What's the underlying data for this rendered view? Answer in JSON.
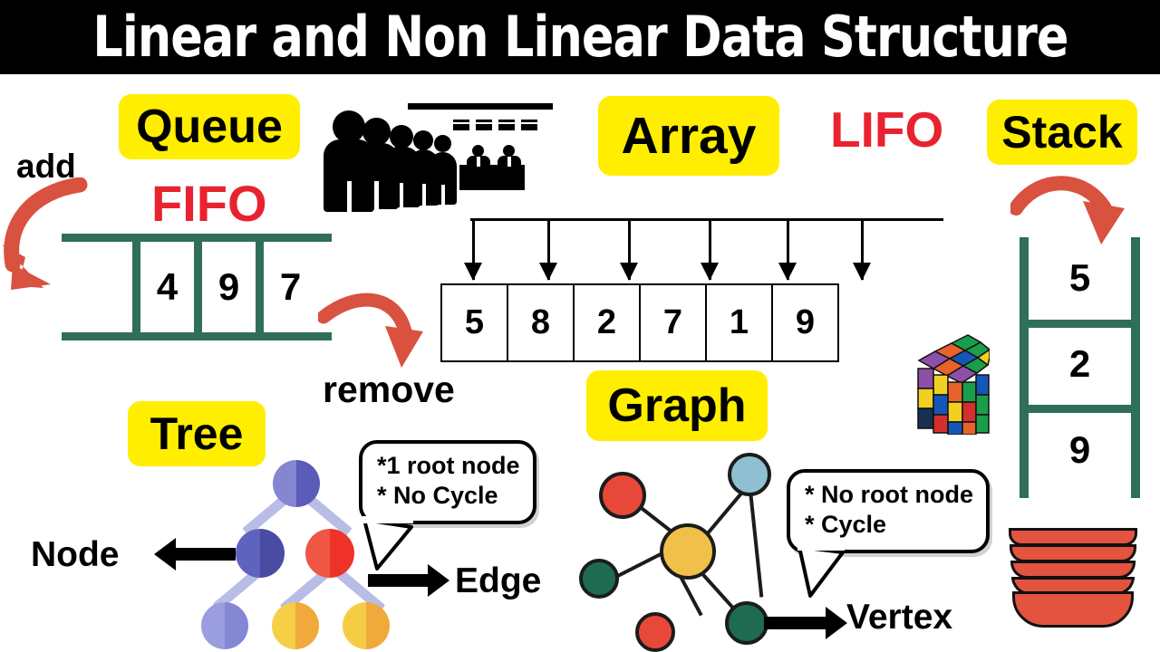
{
  "header": {
    "title": "Linear and Non Linear Data Structure",
    "bg_color": "#000000",
    "text_color": "#ffffff"
  },
  "theme": {
    "badge_bg": "#ffee00",
    "accent_red": "#e8232f",
    "arrow_red": "#d9513f",
    "queue_green": "#2f6e5a",
    "plate_red": "#e3533f"
  },
  "queue": {
    "badge_label": "Queue",
    "principle_label": "FIFO",
    "add_label": "add",
    "remove_label": "remove",
    "cells": [
      "4",
      "9",
      "7"
    ],
    "illustration": "people-in-line-at-counter-icon"
  },
  "array": {
    "badge_label": "Array",
    "cells": [
      "5",
      "8",
      "2",
      "7",
      "1",
      "9"
    ],
    "index_arrow_count": 6
  },
  "stack": {
    "badge_label": "Stack",
    "principle_label": "LIFO",
    "cells": [
      "5",
      "2",
      "9"
    ],
    "illustration": "stack-of-plates-icon",
    "cube_illustration": "rubiks-cube-icon"
  },
  "tree": {
    "badge_label": "Tree",
    "node_label": "Node",
    "edge_label": "Edge",
    "callout": [
      "*1 root node",
      "*  No Cycle"
    ],
    "nodes": [
      {
        "name": "root",
        "left_color": "#8486cf",
        "right_color": "#5a5cb7"
      },
      {
        "name": "left-child",
        "left_color": "#6063bd",
        "right_color": "#4a4ca3"
      },
      {
        "name": "right-child",
        "left_color": "#ef5644",
        "right_color": "#ee322a"
      },
      {
        "name": "leaf-1",
        "left_color": "#9a9ddf",
        "right_color": "#8487d4"
      },
      {
        "name": "leaf-2",
        "left_color": "#f5cf46",
        "right_color": "#f1a93c"
      },
      {
        "name": "leaf-3",
        "left_color": "#f5cd45",
        "right_color": "#f0a93b"
      }
    ]
  },
  "graph": {
    "badge_label": "Graph",
    "vertex_label": "Vertex",
    "callout": [
      "*  No  root node",
      "* Cycle"
    ],
    "nodes": [
      {
        "name": "hub",
        "color": "#f0c04a"
      },
      {
        "name": "red-top",
        "color": "#e8483a"
      },
      {
        "name": "blue-top",
        "color": "#8fc0d2"
      },
      {
        "name": "green-left",
        "color": "#1e6b52"
      },
      {
        "name": "red-bottom",
        "color": "#e8483a"
      },
      {
        "name": "green-bottom",
        "color": "#1e6b52"
      }
    ],
    "edges": [
      [
        "hub",
        "red-top"
      ],
      [
        "hub",
        "blue-top"
      ],
      [
        "hub",
        "green-left"
      ],
      [
        "hub",
        "red-bottom"
      ],
      [
        "hub",
        "green-bottom"
      ],
      [
        "blue-top",
        "green-bottom"
      ]
    ]
  }
}
